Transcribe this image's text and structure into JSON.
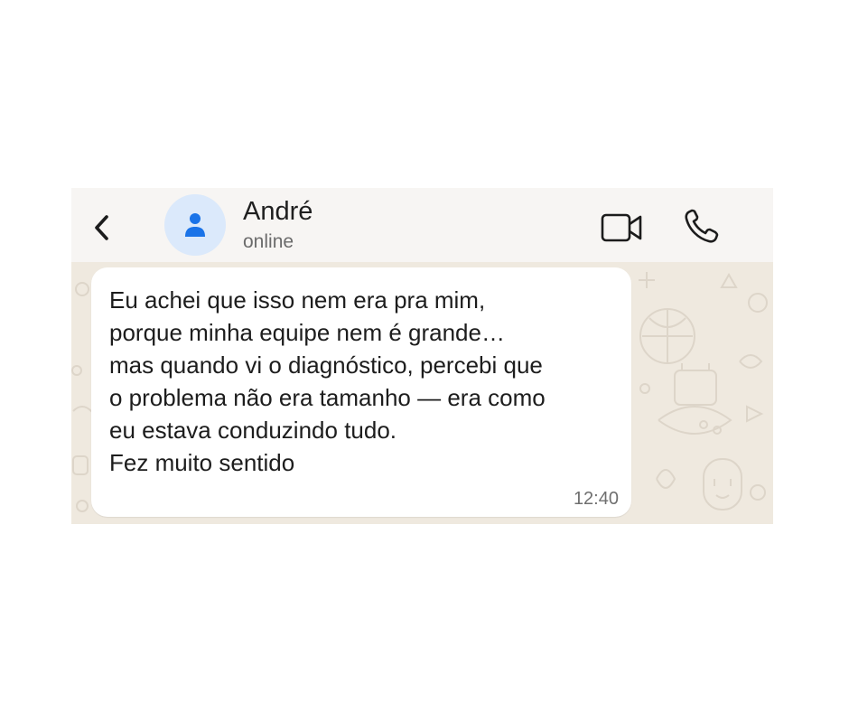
{
  "header": {
    "back_icon": "chevron-left-icon",
    "avatar_icon": "person-icon",
    "contact_name": "André",
    "contact_status": "online",
    "video_icon": "video-camera-icon",
    "call_icon": "phone-icon"
  },
  "messages": [
    {
      "text": "Eu achei que isso nem era pra mim,\nporque minha equipe nem é grande…\nmas quando vi o diagnóstico, percebi que\no problema não era tamanho — era como\neu estava conduzindo tudo.\nFez muito sentido",
      "time": "12:40"
    }
  ],
  "colors": {
    "header_bg": "#f7f5f3",
    "wallpaper_bg": "#efe9df",
    "bubble_bg": "#ffffff",
    "avatar_bg": "#dbe9fb",
    "avatar_accent": "#1a73e8"
  }
}
